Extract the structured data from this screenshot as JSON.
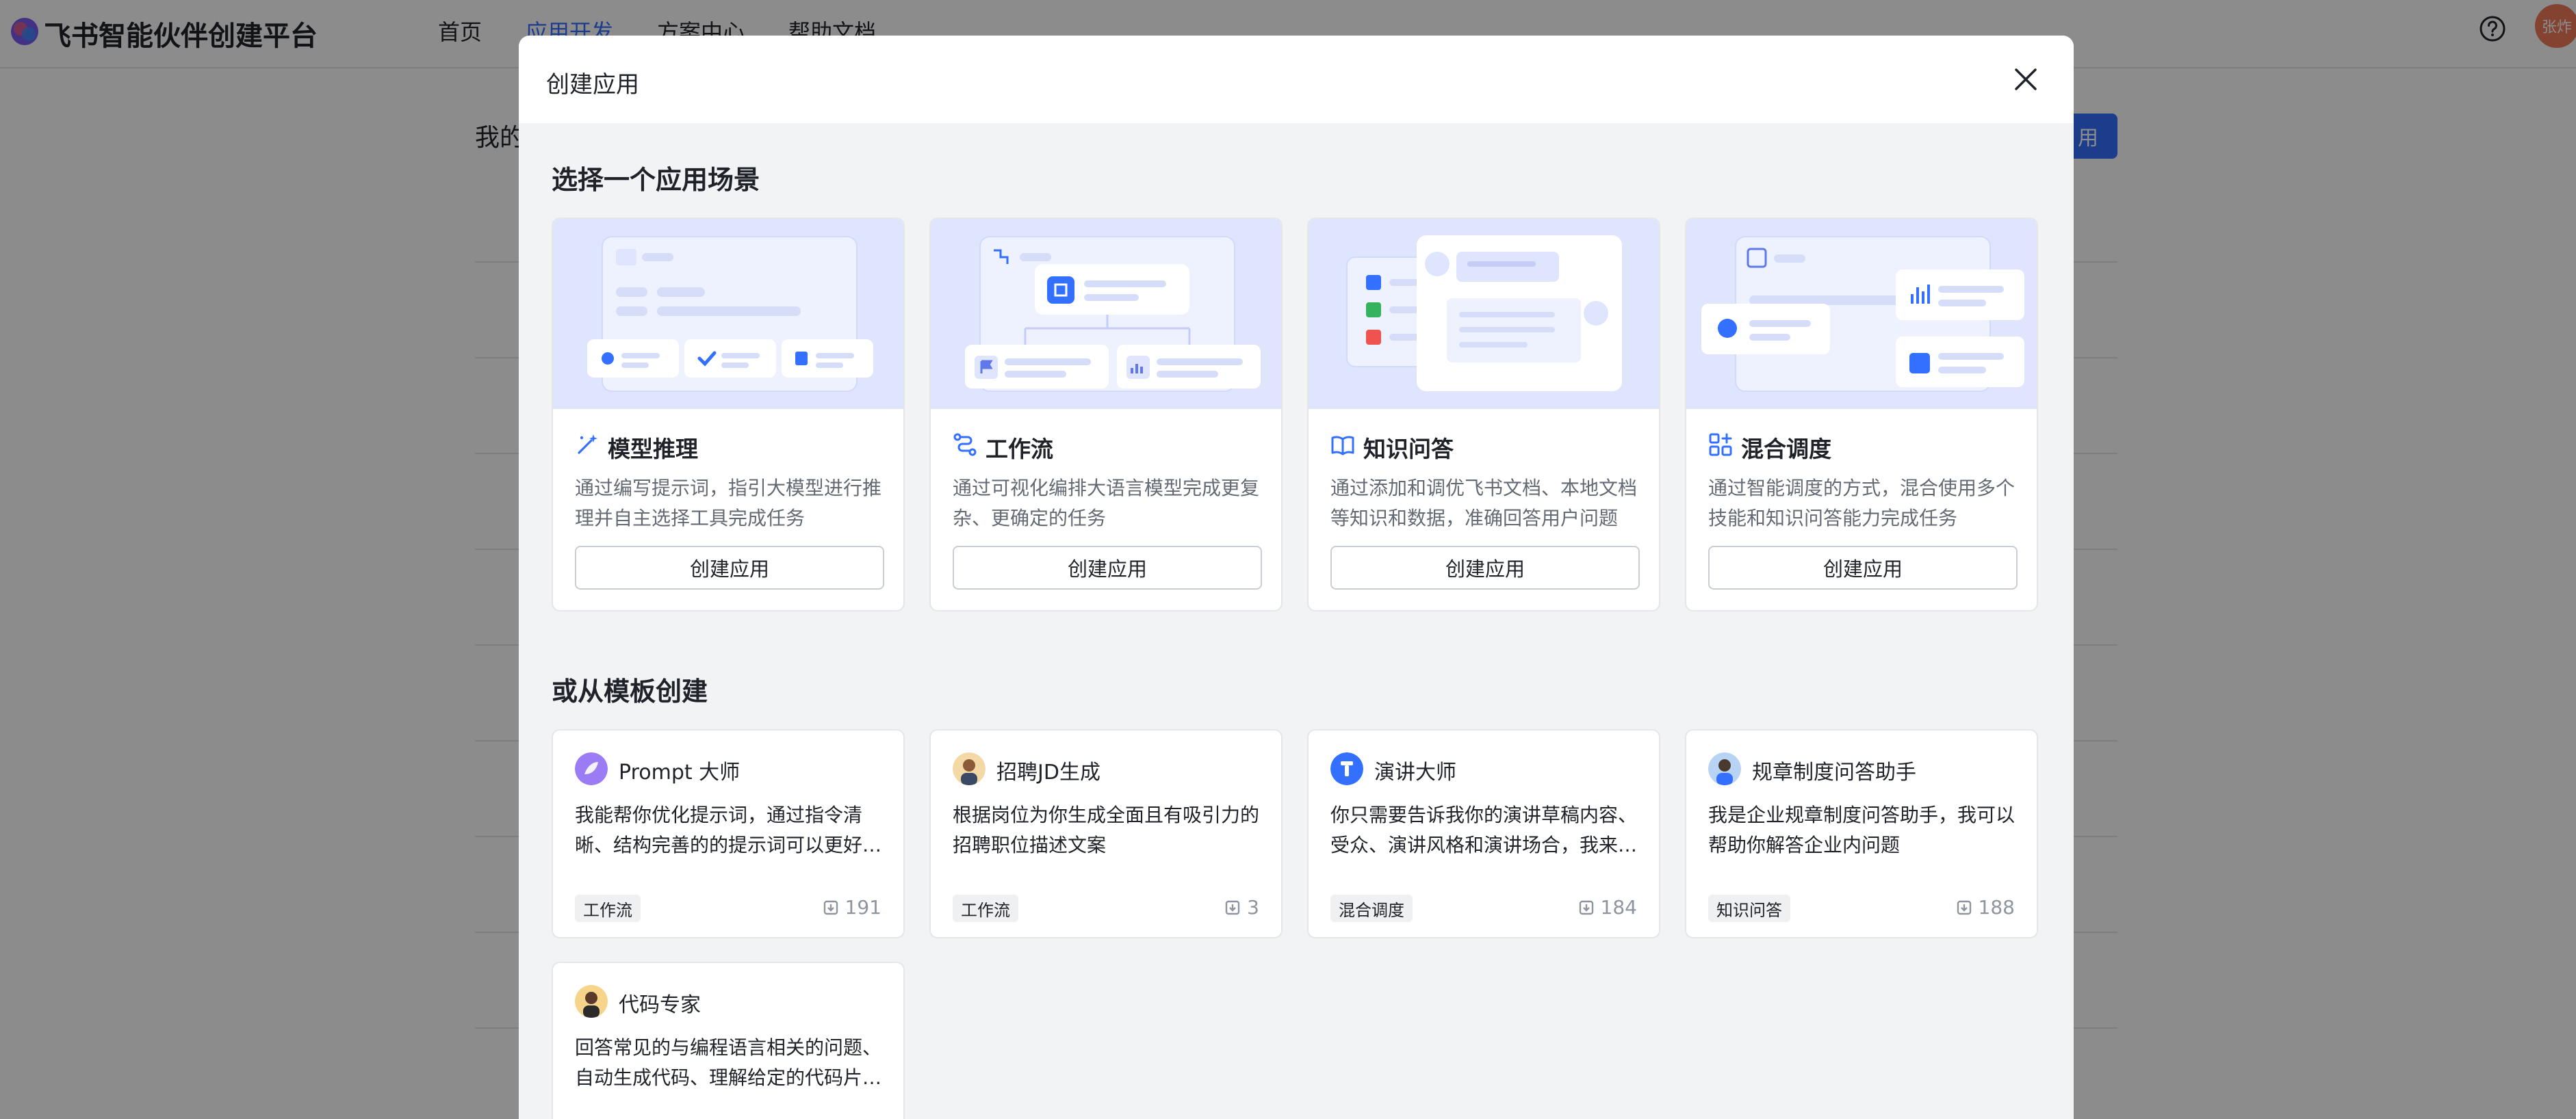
{
  "topbar": {
    "brand": "飞书智能伙伴创建平台",
    "nav": [
      "首页",
      "应用开发",
      "方案中心",
      "帮助文档"
    ],
    "active_nav": "应用开发",
    "avatar_text": "张炸"
  },
  "background": {
    "page_title": "我的",
    "create_button": "用"
  },
  "modal": {
    "title": "创建应用",
    "scene_section_title": "选择一个应用场景",
    "template_section_title": "或从模板创建",
    "scenes": [
      {
        "name": "模型推理",
        "desc": "通过编写提示词，指引大模型进行推理并自主选择工具完成任务",
        "button": "创建应用",
        "icon": "magic-wand-icon"
      },
      {
        "name": "工作流",
        "desc": "通过可视化编排大语言模型完成更复杂、更确定的任务",
        "button": "创建应用",
        "icon": "workflow-icon"
      },
      {
        "name": "知识问答",
        "desc": "通过添加和调优飞书文档、本地文档等知识和数据，准确回答用户问题",
        "button": "创建应用",
        "icon": "open-book-icon"
      },
      {
        "name": "混合调度",
        "desc": "通过智能调度的方式，混合使用多个技能和知识问答能力完成任务",
        "button": "创建应用",
        "icon": "grid-plus-icon"
      }
    ],
    "templates": [
      {
        "name": "Prompt 大师",
        "desc": "我能帮你优化提示词，通过指令清晰、结构完善的的提示词可以更好地引导大模型",
        "tag": "工作流",
        "count": "191"
      },
      {
        "name": "招聘JD生成",
        "desc": "根据岗位为你生成全面且有吸引力的招聘职位描述文案",
        "tag": "工作流",
        "count": "3"
      },
      {
        "name": "演讲大师",
        "desc": "你只需要告诉我你的演讲草稿内容、受众、演讲风格和演讲场合，我来帮你润色",
        "tag": "混合调度",
        "count": "184"
      },
      {
        "name": "规章制度问答助手",
        "desc": "我是企业规章制度问答助手，我可以帮助你解答企业内问题",
        "tag": "知识问答",
        "count": "188"
      },
      {
        "name": "代码专家",
        "desc": "回答常见的与编程语言相关的问题、自动生成代码、理解给定的代码片段并解释",
        "tag": "",
        "count": ""
      }
    ]
  },
  "colors": {
    "accent": "#3370ff",
    "modal_bg": "#f2f3f5",
    "art_bg": "#dfe5fd",
    "overlay": "rgba(0,0,0,0.45)"
  }
}
